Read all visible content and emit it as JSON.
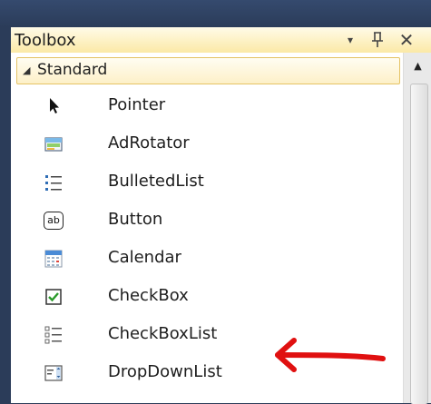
{
  "toolbox": {
    "title": "Toolbox",
    "dropdown_glyph": "▾",
    "pin_glyph": "ᛘ",
    "close_glyph": "✕",
    "category": {
      "arrow": "◢",
      "label": "Standard"
    },
    "scroll_up_glyph": "▲",
    "items": [
      {
        "label": "Pointer",
        "icon": "pointer-icon"
      },
      {
        "label": "AdRotator",
        "icon": "adrotator-icon"
      },
      {
        "label": "BulletedList",
        "icon": "bulleted-list-icon"
      },
      {
        "label": "Button",
        "icon": "button-icon",
        "icon_text": "ab"
      },
      {
        "label": "Calendar",
        "icon": "calendar-icon"
      },
      {
        "label": "CheckBox",
        "icon": "checkbox-icon"
      },
      {
        "label": "CheckBoxList",
        "icon": "checkbox-list-icon"
      },
      {
        "label": "DropDownList",
        "icon": "dropdownlist-icon"
      }
    ]
  },
  "annotation": {
    "arrow_color": "#e01010",
    "points_to": "DropDownList"
  }
}
